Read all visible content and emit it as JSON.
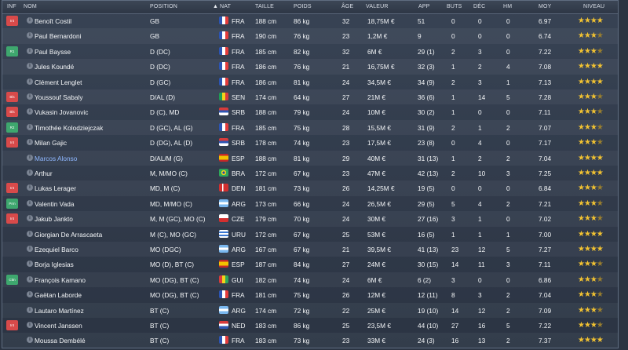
{
  "header": {
    "inf": "INF",
    "nom": "NOM",
    "position": "POSITION",
    "nat": "NAT",
    "taille": "TAILLE",
    "poids": "POIDS",
    "age": "ÂGE",
    "valeur": "VALEUR",
    "app": "APP",
    "buts": "BUTS",
    "dec": "DÉC",
    "hm": "HM",
    "moy": "MOY",
    "niveau": "NIVEAU"
  },
  "players": [
    {
      "inf": "Int",
      "inf_color": "red",
      "name": "Benoît Costil",
      "position": "GB",
      "nat": "FRA",
      "taille": "188 cm",
      "poids": "86 kg",
      "age": "32",
      "valeur": "18,75M €",
      "app": "51",
      "buts": "0",
      "dec": "0",
      "hm": "0",
      "moy": "6.97",
      "stars": "★★★★",
      "half": false,
      "flag": "fra"
    },
    {
      "inf": "",
      "inf_color": "",
      "name": "Paul Bernardoni",
      "position": "GB",
      "nat": "FRA",
      "taille": "190 cm",
      "poids": "76 kg",
      "age": "23",
      "valeur": "1,2M €",
      "app": "9",
      "buts": "0",
      "dec": "0",
      "hm": "0",
      "moy": "6.74",
      "stars": "★★★",
      "half": true,
      "flag": "fra"
    },
    {
      "inf": "R1",
      "inf_color": "green",
      "name": "Paul Baysse",
      "position": "D (DC)",
      "nat": "FRA",
      "taille": "185 cm",
      "poids": "82 kg",
      "age": "32",
      "valeur": "6M €",
      "app": "29 (1)",
      "buts": "2",
      "dec": "3",
      "hm": "0",
      "moy": "7.22",
      "stars": "★★★",
      "half": true,
      "flag": "fra"
    },
    {
      "inf": "",
      "inf_color": "",
      "name": "Jules Koundé",
      "position": "D (DC)",
      "nat": "FRA",
      "taille": "186 cm",
      "poids": "76 kg",
      "age": "21",
      "valeur": "16,75M €",
      "app": "32 (3)",
      "buts": "1",
      "dec": "2",
      "hm": "4",
      "moy": "7.08",
      "stars": "★★★★",
      "half": false,
      "flag": "fra"
    },
    {
      "inf": "",
      "inf_color": "",
      "name": "Clément Lenglet",
      "position": "D (GC)",
      "nat": "FRA",
      "taille": "186 cm",
      "poids": "81 kg",
      "age": "24",
      "valeur": "34,5M €",
      "app": "34 (9)",
      "buts": "2",
      "dec": "3",
      "hm": "1",
      "moy": "7.13",
      "stars": "★★★★",
      "half": false,
      "flag": "fra"
    },
    {
      "inf": "Bls",
      "inf_color": "red",
      "name": "Youssouf Sabaly",
      "position": "D/AL (D)",
      "nat": "SEN",
      "taille": "174 cm",
      "poids": "64 kg",
      "age": "27",
      "valeur": "21M €",
      "app": "36 (6)",
      "buts": "1",
      "dec": "14",
      "hm": "5",
      "moy": "7.28",
      "stars": "★★★",
      "half": true,
      "flag": "sen"
    },
    {
      "inf": "Bls",
      "inf_color": "red",
      "name": "Vukasin Jovanovic",
      "position": "D (C), MD",
      "nat": "SRB",
      "taille": "188 cm",
      "poids": "79 kg",
      "age": "24",
      "valeur": "10M €",
      "app": "30 (2)",
      "buts": "1",
      "dec": "0",
      "hm": "0",
      "moy": "7.11",
      "stars": "★★★",
      "half": true,
      "flag": "srb"
    },
    {
      "inf": "R2",
      "inf_color": "green",
      "name": "Timothée Kolodziejczak",
      "position": "D (GC), AL (G)",
      "nat": "FRA",
      "taille": "185 cm",
      "poids": "75 kg",
      "age": "28",
      "valeur": "15,5M €",
      "app": "31 (9)",
      "buts": "2",
      "dec": "1",
      "hm": "2",
      "moy": "7.07",
      "stars": "★★★",
      "half": true,
      "flag": "fra"
    },
    {
      "inf": "Int",
      "inf_color": "red",
      "name": "Milan Gajic",
      "position": "D (DG), AL (D)",
      "nat": "SRB",
      "taille": "178 cm",
      "poids": "74 kg",
      "age": "23",
      "valeur": "17,5M €",
      "app": "23 (8)",
      "buts": "0",
      "dec": "4",
      "hm": "0",
      "moy": "7.17",
      "stars": "★★★",
      "half": true,
      "flag": "srb"
    },
    {
      "inf": "",
      "inf_color": "",
      "name": "Marcos Alonso",
      "position": "D/AL/M (G)",
      "nat": "ESP",
      "taille": "188 cm",
      "poids": "81 kg",
      "age": "29",
      "valeur": "40M €",
      "app": "31 (13)",
      "buts": "1",
      "dec": "2",
      "hm": "2",
      "moy": "7.04",
      "stars": "★★★★",
      "half": false,
      "flag": "esp",
      "highlight": true
    },
    {
      "inf": "",
      "inf_color": "",
      "name": "Arthur",
      "position": "M, M/MO (C)",
      "nat": "BRA",
      "taille": "172 cm",
      "poids": "67 kg",
      "age": "23",
      "valeur": "47M €",
      "app": "42 (13)",
      "buts": "2",
      "dec": "10",
      "hm": "3",
      "moy": "7.25",
      "stars": "★★★★",
      "half": false,
      "flag": "bra"
    },
    {
      "inf": "Int",
      "inf_color": "red",
      "name": "Lukas Lerager",
      "position": "MD, M (C)",
      "nat": "DEN",
      "taille": "181 cm",
      "poids": "73 kg",
      "age": "26",
      "valeur": "14,25M €",
      "app": "19 (5)",
      "buts": "0",
      "dec": "0",
      "hm": "0",
      "moy": "6.84",
      "stars": "★★★",
      "half": true,
      "flag": "den"
    },
    {
      "inf": "Prm",
      "inf_color": "green",
      "name": "Valentin Vada",
      "position": "MD, M/MO (C)",
      "nat": "ARG",
      "taille": "173 cm",
      "poids": "66 kg",
      "age": "24",
      "valeur": "26,5M €",
      "app": "29 (5)",
      "buts": "5",
      "dec": "4",
      "hm": "2",
      "moy": "7.21",
      "stars": "★★★",
      "half": true,
      "flag": "arg"
    },
    {
      "inf": "Int",
      "inf_color": "red",
      "name": "Jakub Jankto",
      "position": "M, M (GC), MO (C)",
      "nat": "CZE",
      "taille": "179 cm",
      "poids": "70 kg",
      "age": "24",
      "valeur": "30M €",
      "app": "27 (16)",
      "buts": "3",
      "dec": "1",
      "hm": "0",
      "moy": "7.02",
      "stars": "★★★",
      "half": true,
      "flag": "cze"
    },
    {
      "inf": "",
      "inf_color": "",
      "name": "Giorgian De Arrascaeta",
      "position": "M (C), MO (GC)",
      "nat": "URU",
      "taille": "172 cm",
      "poids": "67 kg",
      "age": "25",
      "valeur": "53M €",
      "app": "16 (5)",
      "buts": "1",
      "dec": "1",
      "hm": "1",
      "moy": "7.00",
      "stars": "★★★★",
      "half": false,
      "flag": "uru"
    },
    {
      "inf": "",
      "inf_color": "",
      "name": "Ezequiel Barco",
      "position": "MO (DGC)",
      "nat": "ARG",
      "taille": "167 cm",
      "poids": "67 kg",
      "age": "21",
      "valeur": "39,5M €",
      "app": "41 (13)",
      "buts": "23",
      "dec": "12",
      "hm": "5",
      "moy": "7.27",
      "stars": "★★★★",
      "half": false,
      "flag": "arg"
    },
    {
      "inf": "",
      "inf_color": "",
      "name": "Borja Iglesias",
      "position": "MO (D), BT (C)",
      "nat": "ESP",
      "taille": "187 cm",
      "poids": "84 kg",
      "age": "27",
      "valeur": "24M €",
      "app": "30 (15)",
      "buts": "14",
      "dec": "11",
      "hm": "3",
      "moy": "7.11",
      "stars": "★★★",
      "half": true,
      "flag": "esp"
    },
    {
      "inf": "Cttn",
      "inf_color": "green",
      "name": "François Kamano",
      "position": "MO (DG), BT (C)",
      "nat": "GUI",
      "taille": "182 cm",
      "poids": "74 kg",
      "age": "24",
      "valeur": "6M €",
      "app": "6 (2)",
      "buts": "3",
      "dec": "0",
      "hm": "0",
      "moy": "6.86",
      "stars": "★★★",
      "half": true,
      "flag": "gui"
    },
    {
      "inf": "",
      "inf_color": "",
      "name": "Gaëtan Laborde",
      "position": "MO (DG), BT (C)",
      "nat": "FRA",
      "taille": "181 cm",
      "poids": "75 kg",
      "age": "26",
      "valeur": "12M €",
      "app": "12 (11)",
      "buts": "8",
      "dec": "3",
      "hm": "2",
      "moy": "7.04",
      "stars": "★★★",
      "half": true,
      "flag": "fra"
    },
    {
      "inf": "",
      "inf_color": "",
      "name": "Lautaro Martínez",
      "position": "BT (C)",
      "nat": "ARG",
      "taille": "174 cm",
      "poids": "72 kg",
      "age": "22",
      "valeur": "25M €",
      "app": "19 (10)",
      "buts": "14",
      "dec": "12",
      "hm": "2",
      "moy": "7.09",
      "stars": "★★★",
      "half": true,
      "flag": "arg"
    },
    {
      "inf": "Int",
      "inf_color": "red",
      "name": "Vincent Janssen",
      "position": "BT (C)",
      "nat": "NED",
      "taille": "183 cm",
      "poids": "86 kg",
      "age": "25",
      "valeur": "23,5M €",
      "app": "44 (10)",
      "buts": "27",
      "dec": "16",
      "hm": "5",
      "moy": "7.22",
      "stars": "★★★",
      "half": true,
      "flag": "ned"
    },
    {
      "inf": "",
      "inf_color": "",
      "name": "Moussa Dembélé",
      "position": "BT (C)",
      "nat": "FRA",
      "taille": "183 cm",
      "poids": "73 kg",
      "age": "23",
      "valeur": "33M €",
      "app": "24 (3)",
      "buts": "16",
      "dec": "13",
      "hm": "2",
      "moy": "7.37",
      "stars": "★★★★",
      "half": false,
      "flag": "fra"
    }
  ],
  "colors": {
    "background": "#2b3442",
    "panel": "#3a4556",
    "red_badge": "#d84a4a",
    "green_badge": "#3ea76e",
    "star": "#f1c232"
  }
}
